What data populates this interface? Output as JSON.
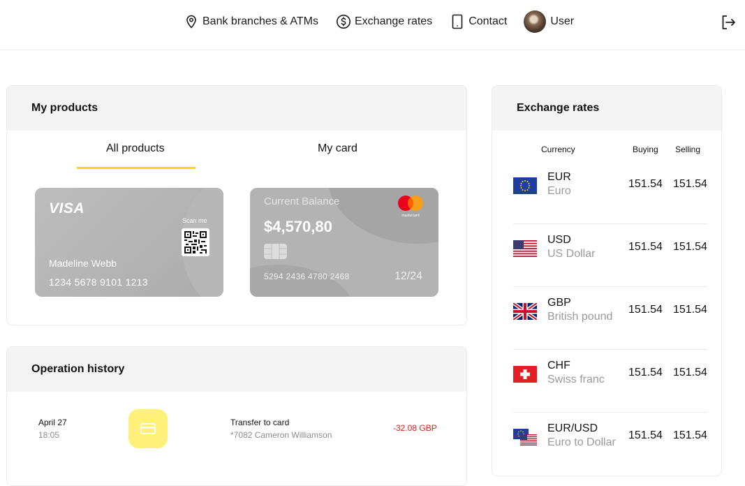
{
  "nav": {
    "items": [
      {
        "label": "Bank branches & ATMs",
        "icon": "location-pin-icon"
      },
      {
        "label": "Exchange rates",
        "icon": "dollar-circle-icon"
      },
      {
        "label": "Contact",
        "icon": "phone-icon"
      },
      {
        "label": "User",
        "icon": "avatar"
      }
    ],
    "logout_icon": "logout-icon"
  },
  "products": {
    "title": "My products",
    "tabs": [
      {
        "label": "All products",
        "active": true
      },
      {
        "label": "My card",
        "active": false
      }
    ],
    "accent_color": "#ffd60a",
    "visa_card": {
      "brand": "VISA",
      "scan_label": "Scan me",
      "holder": "Madeline Webb",
      "number": "1234 5678 9101 1213"
    },
    "master_card": {
      "balance_label": "Current Balance",
      "balance": "$4,570,80",
      "brand_small": "mastercard",
      "number": "5294 2436 4780 2468",
      "expiry": "12/24"
    }
  },
  "history": {
    "title": "Operation history",
    "operations": [
      {
        "date": "April 27",
        "time": "18:05",
        "icon": "card-icon",
        "title": "Transfer to card",
        "subtitle": "*7082 Cameron Williamson",
        "amount": "-32.08 GBP",
        "amount_color": "#e01b1b"
      }
    ]
  },
  "rates": {
    "title": "Exchange rates",
    "columns": {
      "currency": "Currency",
      "buying": "Buying",
      "selling": "Selling"
    },
    "rows": [
      {
        "code": "EUR",
        "name": "Euro",
        "buying": "151.54",
        "selling": "151.54",
        "flag": "eu-flag-icon"
      },
      {
        "code": "USD",
        "name": "US Dollar",
        "buying": "151.54",
        "selling": "151.54",
        "flag": "us-flag-icon"
      },
      {
        "code": "GBP",
        "name": "British pound",
        "buying": "151.54",
        "selling": "151.54",
        "flag": "uk-flag-icon"
      },
      {
        "code": "CHF",
        "name": "Swiss franc",
        "buying": "151.54",
        "selling": "151.54",
        "flag": "swiss-flag-icon"
      },
      {
        "code": "EUR/USD",
        "name": "Euro to Dollar",
        "buying": "151.54",
        "selling": "151.54",
        "flag": "eu-us-flag-icon"
      }
    ]
  }
}
